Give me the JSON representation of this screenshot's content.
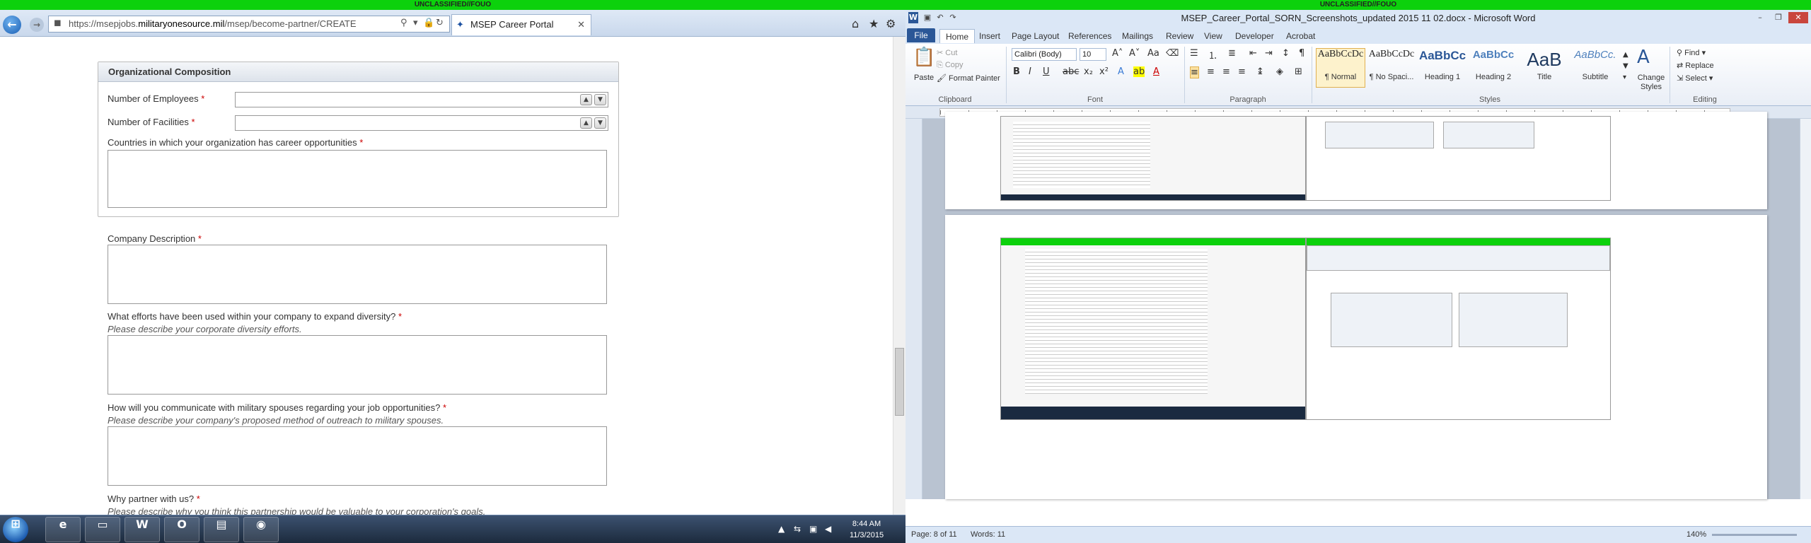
{
  "banner": {
    "text": "UNCLASSIFIED//FOUO"
  },
  "ie": {
    "address_prefix": "https://msepjobs.",
    "address_domain": "militaryonesource.mil",
    "address_suffix": "/msep/become-partner/CREATE",
    "tab_title": "MSEP Career Portal",
    "tab_close": "✕"
  },
  "form": {
    "section_title": "Organizational Composition",
    "employees_label": "Number of Employees",
    "facilities_label": "Number of Facilities",
    "countries_label": "Countries in which your organization has career opportunities",
    "description_label": "Company Description",
    "diversity_label": "What efforts have been used within your company to expand diversity?",
    "diversity_hint": "Please describe your corporate diversity efforts.",
    "outreach_label": "How will you communicate with military spouses regarding your job opportunities?",
    "outreach_hint": "Please describe your company's proposed method of outreach to military spouses.",
    "partner_label": "Why partner with us?",
    "partner_hint": "Please describe why you think this partnership would be valuable to your corporation's goals.",
    "required_mark": "*"
  },
  "word": {
    "title": "MSEP_Career_Portal_SORN_Screenshots_updated 2015 11 02.docx - Microsoft Word",
    "tabs": [
      "File",
      "Home",
      "Insert",
      "Page Layout",
      "References",
      "Mailings",
      "Review",
      "View",
      "Developer",
      "Acrobat"
    ],
    "clipboard": {
      "paste": "Paste",
      "cut": "Cut",
      "copy": "Copy",
      "format_painter": "Format Painter",
      "group": "Clipboard"
    },
    "font": {
      "name": "Calibri (Body)",
      "size": "10",
      "group": "Font"
    },
    "paragraph_group": "Paragraph",
    "styles": [
      {
        "preview": "AaBbCcDc",
        "name": "¶ Normal"
      },
      {
        "preview": "AaBbCcDc",
        "name": "¶ No Spaci..."
      },
      {
        "preview": "AaBbCc",
        "name": "Heading 1"
      },
      {
        "preview": "AaBbCc",
        "name": "Heading 2"
      },
      {
        "preview": "AaB",
        "name": "Title"
      },
      {
        "preview": "AaBbCc.",
        "name": "Subtitle"
      }
    ],
    "styles_group": "Styles",
    "change_styles": "Change Styles",
    "editing": {
      "find": "Find",
      "replace": "Replace",
      "select": "Select",
      "group": "Editing"
    },
    "status": {
      "page": "Page: 8 of 11",
      "words": "Words: 11",
      "zoom": "140%"
    }
  },
  "taskbar": {
    "start": "⊞",
    "time": "8:44 AM",
    "date": "11/3/2015"
  },
  "colors": {
    "banner": "#0cd10c",
    "required": "#cc0000",
    "word_blue": "#2b5797"
  }
}
